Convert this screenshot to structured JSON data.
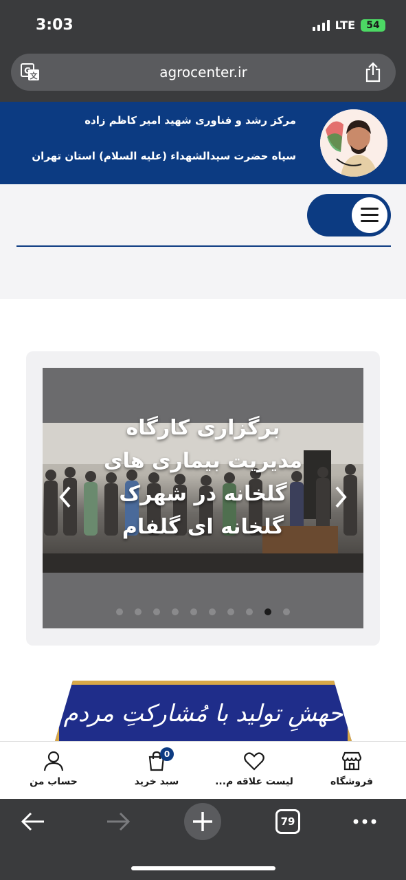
{
  "status": {
    "time": "3:03",
    "network": "LTE",
    "battery": "54"
  },
  "browser": {
    "url": "agrocenter.ir",
    "tab_count": "79"
  },
  "header": {
    "line1": "مرکز رشد و فناوری شهید امیر کاظم زاده",
    "line2": "سپاه حضرت سیدالشهداء (علیه السلام) استان تهران"
  },
  "slider": {
    "title": "برگزاری کارگاه مدیریت بیماری های گلخانه در شهرک گلخانه ای گلفام",
    "dot_count": 10,
    "active_index": 8
  },
  "banner": {
    "text": "حهشِ تولید با مُشارکتِ مردم"
  },
  "bottom_nav": {
    "shop": "فروشگاه",
    "wishlist": "لیست علاقه م...",
    "cart": "سبد خرید",
    "cart_count": "0",
    "account": "حساب من"
  },
  "colors": {
    "brand_blue": "#0c3b82",
    "browser_chrome": "#3a3b3d",
    "battery_green": "#4cd964"
  }
}
